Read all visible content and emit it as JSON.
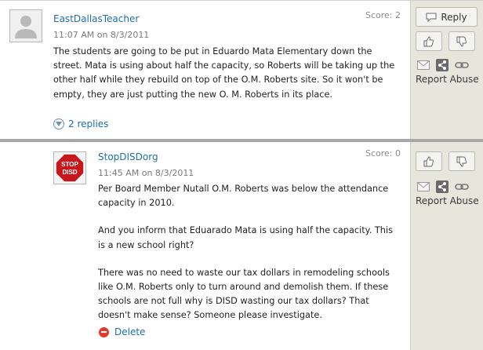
{
  "comments": [
    {
      "author": "EastDallasTeacher",
      "timestamp": "11:07 AM on 8/3/2011",
      "score": "Score: 2",
      "paragraphs": [
        "The students are going to be put in Eduardo Mata Elementary down the street. Mata is using about half the capacity, so Roberts will be taking up the other half while they rebuild on top of the O.M. Roberts site. So it won't be empty, they are just putting the new O. M. Roberts in its place."
      ],
      "replies_link": "2 replies",
      "reply_button": "Reply",
      "report_abuse": "Report Abuse",
      "avatar": "default-user-avatar"
    },
    {
      "author": "StopDISDorg",
      "timestamp": "11:45 AM on 8/3/2011",
      "score": "Score: 0",
      "paragraphs": [
        "Per Board Member Nutall O.M. Roberts was below the attendance capacity in 2010.",
        "And you inform that Eduarado Mata is using half the capacity. This is a new school right?",
        "There was no need to waste our tax dollars in remodeling schools like O.M. Roberts only to turn around and demolish them. If these schools are not full why is DISD wasting our tax dollars? That doesn't make sense? Someone please investigate."
      ],
      "delete_link": "Delete",
      "report_abuse": "Report Abuse",
      "avatar": "stop-sign-avatar",
      "avatar_text": [
        "STOP",
        "DISD"
      ]
    }
  ],
  "colors": {
    "link": "#1f6fa8",
    "sidebar": "#e6e6dd",
    "delete_icon": "#e03c2e"
  }
}
